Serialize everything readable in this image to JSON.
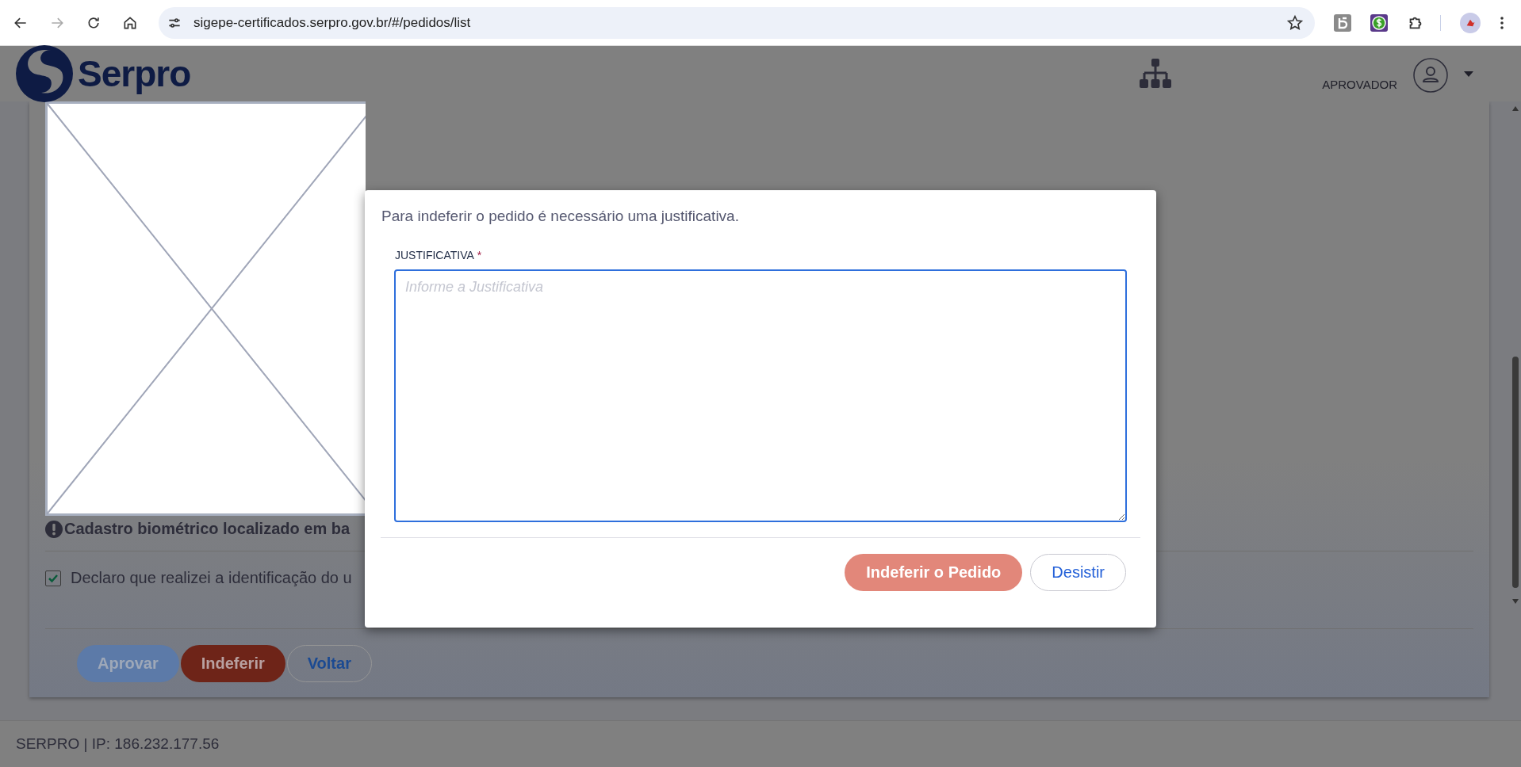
{
  "browser": {
    "url": "sigepe-certificados.serpro.gov.br/#/pedidos/list"
  },
  "header": {
    "logo_text": "Serpro",
    "role": "APROVADOR"
  },
  "content": {
    "notice": "Cadastro biométrico localizado em ba",
    "declaration": {
      "label": "Declaro que realizei a identificação do u",
      "checked": true
    },
    "buttons": [
      {
        "label": "Aprovar",
        "kind": "primary"
      },
      {
        "label": "Indeferir",
        "kind": "danger"
      },
      {
        "label": "Voltar",
        "kind": "secondary"
      }
    ]
  },
  "modal": {
    "message": "Para indeferir o pedido é necessário uma justificativa.",
    "field": {
      "label": "JUSTIFICATIVA",
      "required": true,
      "required_mark": "*",
      "placeholder": "Informe a Justificativa"
    },
    "buttons": [
      {
        "label": "Indeferir o Pedido",
        "kind": "danger"
      },
      {
        "label": "Desistir",
        "kind": "secondary"
      }
    ]
  },
  "footer": {
    "text": "SERPRO | IP: 186.232.177.56"
  }
}
